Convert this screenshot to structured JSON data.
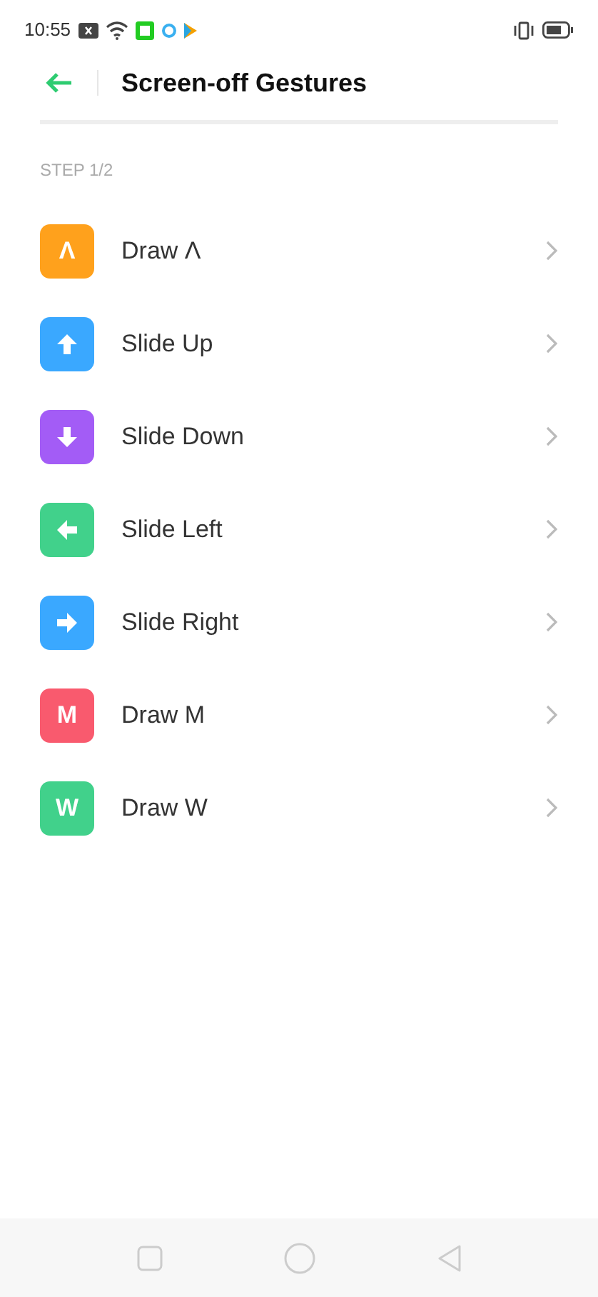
{
  "status_bar": {
    "time": "10:55"
  },
  "header": {
    "title": "Screen-off Gestures"
  },
  "section": {
    "label": "STEP 1/2"
  },
  "gestures": [
    {
      "kind": "letter",
      "badge": "Λ",
      "label": "Draw Λ",
      "color": "#ffa11c"
    },
    {
      "kind": "up",
      "label": "Slide Up",
      "color": "#3aa8ff"
    },
    {
      "kind": "down",
      "label": "Slide Down",
      "color": "#a35cf6"
    },
    {
      "kind": "left",
      "label": "Slide Left",
      "color": "#41d18b"
    },
    {
      "kind": "right",
      "label": "Slide Right",
      "color": "#3aa8ff"
    },
    {
      "kind": "letter",
      "badge": "M",
      "label": "Draw M",
      "color": "#f95a6e"
    },
    {
      "kind": "letter",
      "badge": "W",
      "label": "Draw W",
      "color": "#41d18b"
    }
  ]
}
